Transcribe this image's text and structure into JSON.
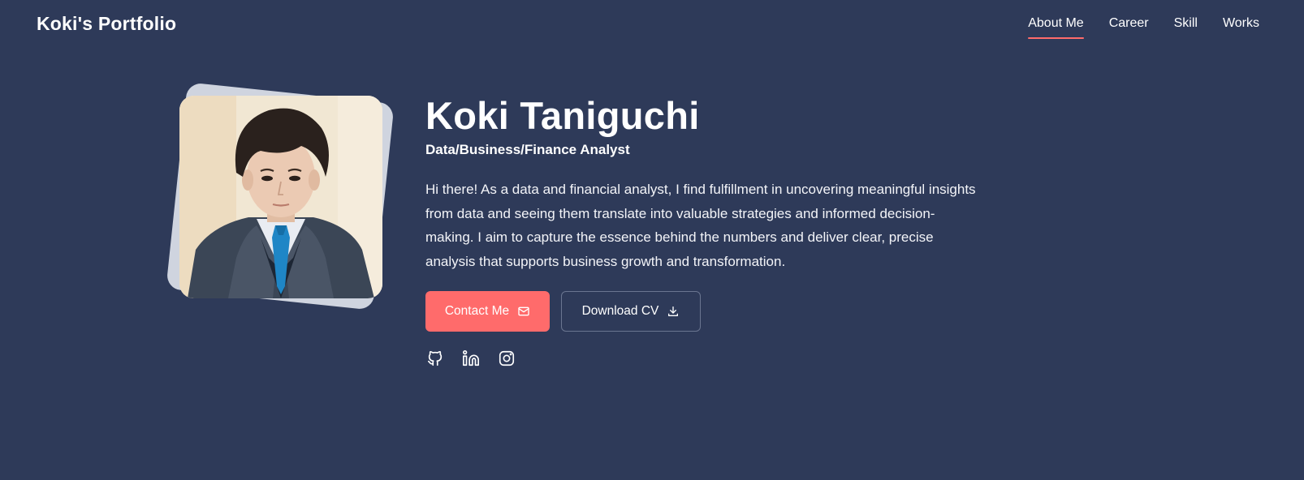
{
  "brand": "Koki's Portfolio",
  "nav": {
    "items": [
      {
        "label": "About Me",
        "active": true
      },
      {
        "label": "Career",
        "active": false
      },
      {
        "label": "Skill",
        "active": false
      },
      {
        "label": "Works",
        "active": false
      }
    ]
  },
  "hero": {
    "name": "Koki Taniguchi",
    "role": "Data/Business/Finance Analyst",
    "description": "Hi there! As a data and financial analyst, I find fulfillment in uncovering meaningful insights from data and seeing them translate into valuable strategies and informed decision-making. I aim to capture the essence behind the numbers and deliver clear, precise analysis that supports business growth and transformation.",
    "contact_label": "Contact Me",
    "contact_icon": "mail-icon",
    "download_label": "Download CV",
    "download_icon": "download-icon",
    "socials": [
      "github-icon",
      "linkedin-icon",
      "instagram-icon"
    ]
  },
  "colors": {
    "background": "#2e3a59",
    "accent": "#ff6b6b",
    "text": "#ffffff"
  }
}
